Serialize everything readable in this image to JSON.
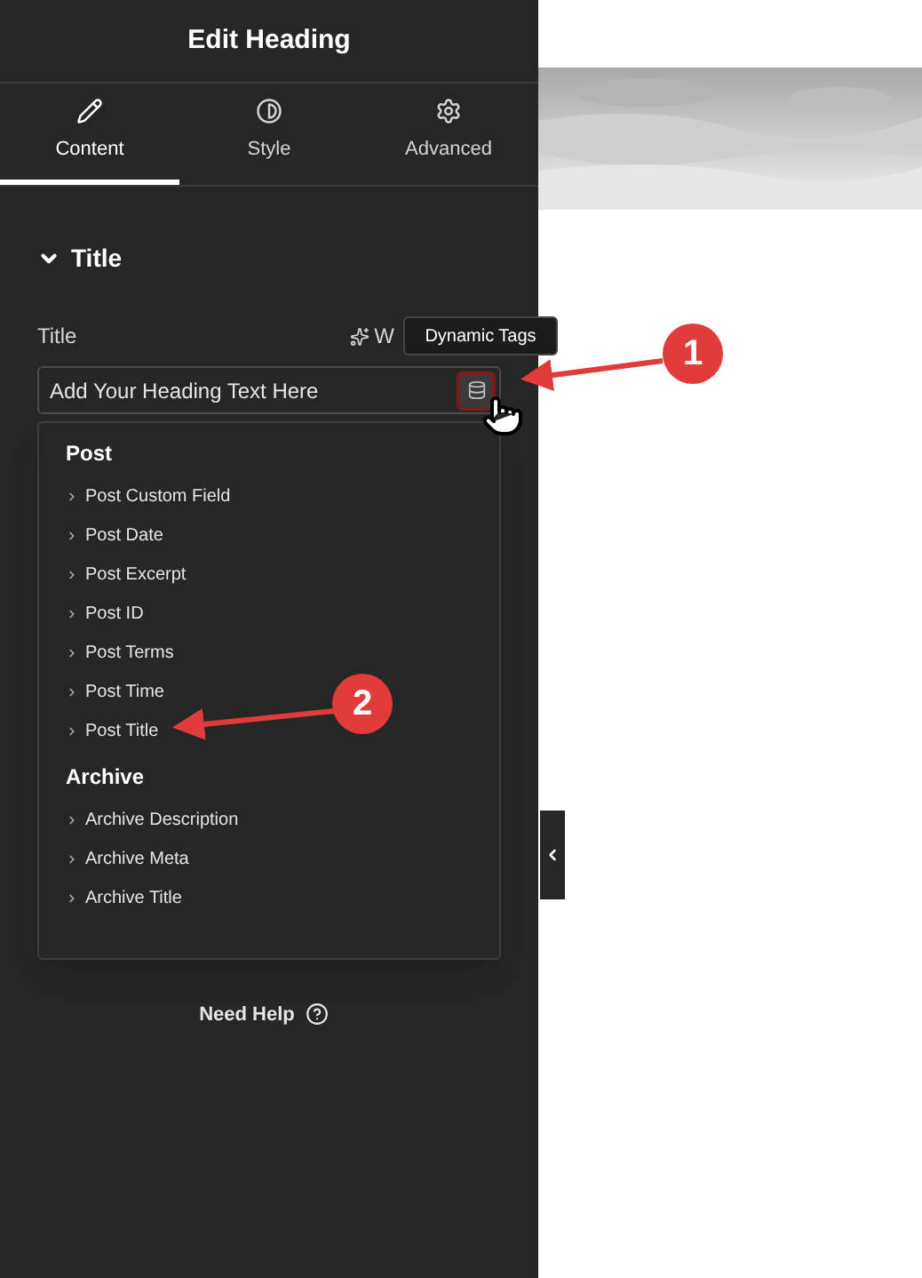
{
  "panel": {
    "title": "Edit Heading"
  },
  "tabs": [
    {
      "label": "Content",
      "selected": true
    },
    {
      "label": "Style",
      "selected": false
    },
    {
      "label": "Advanced",
      "selected": false
    }
  ],
  "section": {
    "title": "Title",
    "expanded": true
  },
  "field": {
    "label": "Title",
    "ai_label": "W",
    "value": "Add Your Heading Text Here",
    "tooltip": "Dynamic Tags"
  },
  "dropdown": {
    "groups": [
      {
        "title": "Post",
        "items": [
          "Post Custom Field",
          "Post Date",
          "Post Excerpt",
          "Post ID",
          "Post Terms",
          "Post Time",
          "Post Title"
        ]
      },
      {
        "title": "Archive",
        "items": [
          "Archive Description",
          "Archive Meta",
          "Archive Title"
        ]
      }
    ]
  },
  "help": {
    "label": "Need Help"
  },
  "annotations": [
    {
      "number": "1"
    },
    {
      "number": "2"
    }
  ]
}
